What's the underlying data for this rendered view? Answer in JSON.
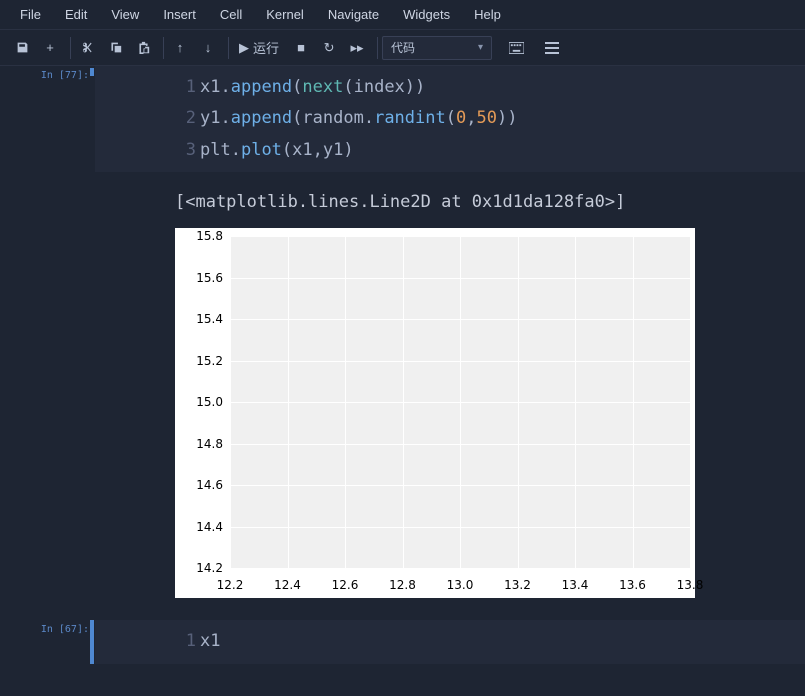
{
  "menu": {
    "items": [
      "File",
      "Edit",
      "View",
      "Insert",
      "Cell",
      "Kernel",
      "Navigate",
      "Widgets",
      "Help"
    ]
  },
  "toolbar": {
    "save_title": "Save",
    "run_label": "运行",
    "celltype_selected": "代码"
  },
  "cells": [
    {
      "prompt": "In [77]:",
      "code_lines": [
        {
          "n": "1",
          "html": "<span class='tok-name'>x1</span><span class='tok-punc'>.</span><span class='tok-call'>append</span><span class='tok-punc'>(</span><span class='tok-built'>next</span><span class='tok-punc'>(</span><span class='tok-name'>index</span><span class='tok-punc'>))</span>"
        },
        {
          "n": "2",
          "html": "<span class='tok-name'>y1</span><span class='tok-punc'>.</span><span class='tok-call'>append</span><span class='tok-punc'>(</span><span class='tok-name'>random</span><span class='tok-punc'>.</span><span class='tok-call'>randint</span><span class='tok-punc'>(</span><span class='tok-num'>0</span><span class='tok-punc'>,</span><span class='tok-num'>50</span><span class='tok-punc'>))</span>"
        },
        {
          "n": "3",
          "html": "<span class='tok-name'>plt</span><span class='tok-punc'>.</span><span class='tok-call'>plot</span><span class='tok-punc'>(</span><span class='tok-name'>x1</span><span class='tok-punc'>,</span><span class='tok-name'>y1</span><span class='tok-punc'>)</span>"
        }
      ],
      "output_text": "[<matplotlib.lines.Line2D at 0x1d1da128fa0>]"
    },
    {
      "prompt": "In [67]:",
      "code_lines": [
        {
          "n": "1",
          "html": "<span class='tok-name'>x1</span>"
        }
      ]
    }
  ],
  "chart_data": {
    "type": "line",
    "title": "",
    "xlabel": "",
    "ylabel": "",
    "x_ticks": [
      12.2,
      12.4,
      12.6,
      12.8,
      13.0,
      13.2,
      13.4,
      13.6,
      13.8
    ],
    "y_ticks": [
      14.2,
      14.4,
      14.6,
      14.8,
      15.0,
      15.2,
      15.4,
      15.6,
      15.8
    ],
    "xlim": [
      12.2,
      13.8
    ],
    "ylim": [
      14.2,
      15.8
    ],
    "series": []
  }
}
